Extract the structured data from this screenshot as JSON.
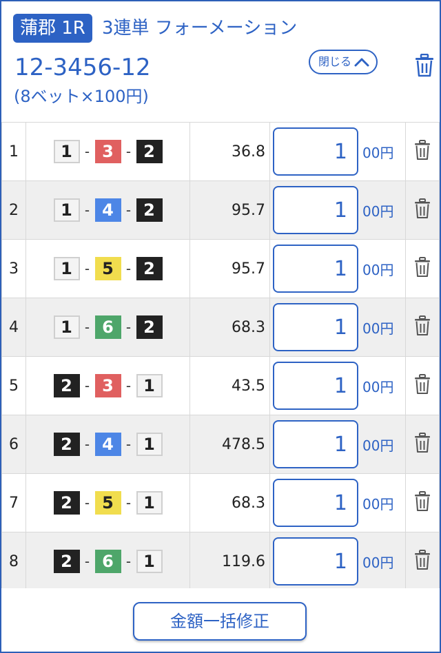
{
  "header": {
    "venue": "蒲郡 1R",
    "bet_type": "3連単 フォーメーション",
    "combination": "12-3456-12",
    "bet_summary": "(8ベット×100円)",
    "close_label": "閉じる"
  },
  "colors": {
    "accent": "#2d62c4",
    "boat_1": "#f4f4f4",
    "boat_2": "#222222",
    "boat_3": "#e06060",
    "boat_4": "#4d86e6",
    "boat_5": "#f1dd4e",
    "boat_6": "#4ea66a"
  },
  "rows": [
    {
      "no": "1",
      "first": "1",
      "second": "3",
      "third": "2",
      "odds": "36.8",
      "amount": "1",
      "unit": "00円"
    },
    {
      "no": "2",
      "first": "1",
      "second": "4",
      "third": "2",
      "odds": "95.7",
      "amount": "1",
      "unit": "00円"
    },
    {
      "no": "3",
      "first": "1",
      "second": "5",
      "third": "2",
      "odds": "95.7",
      "amount": "1",
      "unit": "00円"
    },
    {
      "no": "4",
      "first": "1",
      "second": "6",
      "third": "2",
      "odds": "68.3",
      "amount": "1",
      "unit": "00円"
    },
    {
      "no": "5",
      "first": "2",
      "second": "3",
      "third": "1",
      "odds": "43.5",
      "amount": "1",
      "unit": "00円"
    },
    {
      "no": "6",
      "first": "2",
      "second": "4",
      "third": "1",
      "odds": "478.5",
      "amount": "1",
      "unit": "00円"
    },
    {
      "no": "7",
      "first": "2",
      "second": "5",
      "third": "1",
      "odds": "68.3",
      "amount": "1",
      "unit": "00円"
    },
    {
      "no": "8",
      "first": "2",
      "second": "6",
      "third": "1",
      "odds": "119.6",
      "amount": "1",
      "unit": "00円"
    }
  ],
  "separator": "-",
  "footer": {
    "bulk_edit_label": "金額一括修正"
  }
}
